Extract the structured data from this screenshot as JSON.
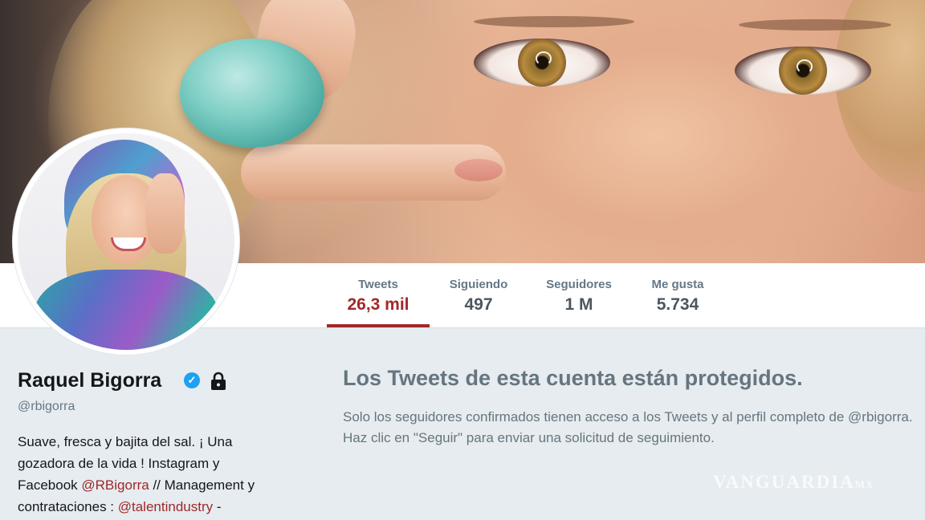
{
  "profile": {
    "name": "Raquel Bigorra",
    "handle": "@rbigorra",
    "bio": {
      "part1": "Suave, fresca y bajita del sal. ¡ Una gozadora de la vida ! Instagram y Facebook ",
      "mention1": "@RBigorra",
      "part2": " // Management y contrataciones : ",
      "mention2": "@talentindustry",
      "part3": " -"
    },
    "verified_icon": "verified-badge-icon",
    "lock_icon": "lock-icon"
  },
  "nav": {
    "tweets": {
      "label": "Tweets",
      "value": "26,3 mil"
    },
    "following": {
      "label": "Siguiendo",
      "value": "497"
    },
    "followers": {
      "label": "Seguidores",
      "value": "1 M"
    },
    "likes": {
      "label": "Me gusta",
      "value": "5.734"
    }
  },
  "protected": {
    "title": "Los Tweets de esta cuenta están protegidos.",
    "message": "Solo los seguidores confirmados tienen acceso a los Tweets y al perfil completo de @rbigorra. Haz clic en \"Seguir\" para enviar una solicitud de seguimiento."
  },
  "watermark": {
    "text": "VANGUARDIA",
    "suffix": "MX"
  },
  "colors": {
    "accent": "#a0282a",
    "verified": "#1da1f2",
    "muted_text": "#657786",
    "page_background": "#e6ecf0"
  }
}
